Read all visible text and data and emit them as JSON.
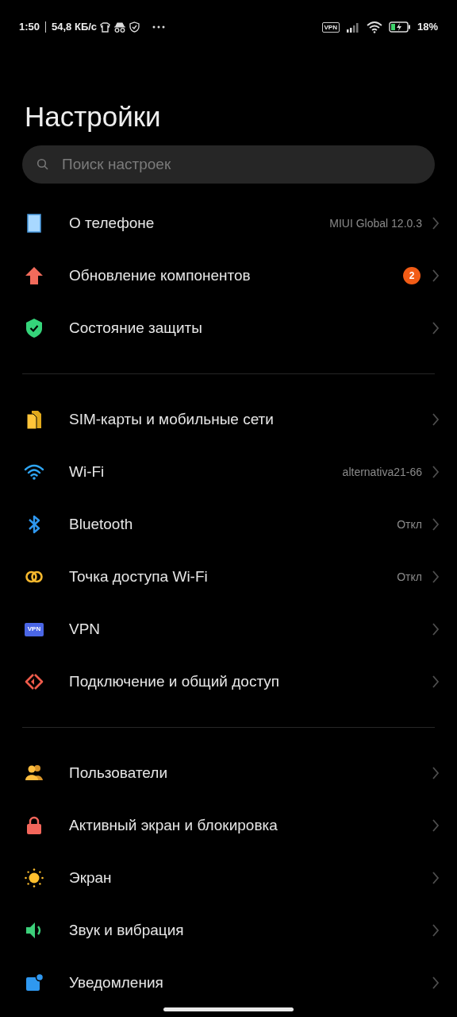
{
  "status_bar": {
    "time": "1:50",
    "speed": "54,8 КБ/с",
    "vpn": "VPN",
    "battery": "18%"
  },
  "title": "Настройки",
  "search": {
    "placeholder": "Поиск настроек"
  },
  "groups": [
    [
      {
        "label": "О телефоне",
        "value": "MIUI Global 12.0.3"
      },
      {
        "label": "Обновление компонентов",
        "badge": "2"
      },
      {
        "label": "Состояние защиты"
      }
    ],
    [
      {
        "label": "SIM-карты и мобильные сети"
      },
      {
        "label": "Wi-Fi",
        "value": "alternativa21-66"
      },
      {
        "label": "Bluetooth",
        "value": "Откл"
      },
      {
        "label": "Точка доступа Wi-Fi",
        "value": "Откл"
      },
      {
        "label": "VPN",
        "icon_text": "VPN"
      },
      {
        "label": "Подключение и общий доступ"
      }
    ],
    [
      {
        "label": "Пользователи"
      },
      {
        "label": "Активный экран и блокировка"
      },
      {
        "label": "Экран"
      },
      {
        "label": "Звук и вибрация"
      },
      {
        "label": "Уведомления"
      }
    ]
  ]
}
